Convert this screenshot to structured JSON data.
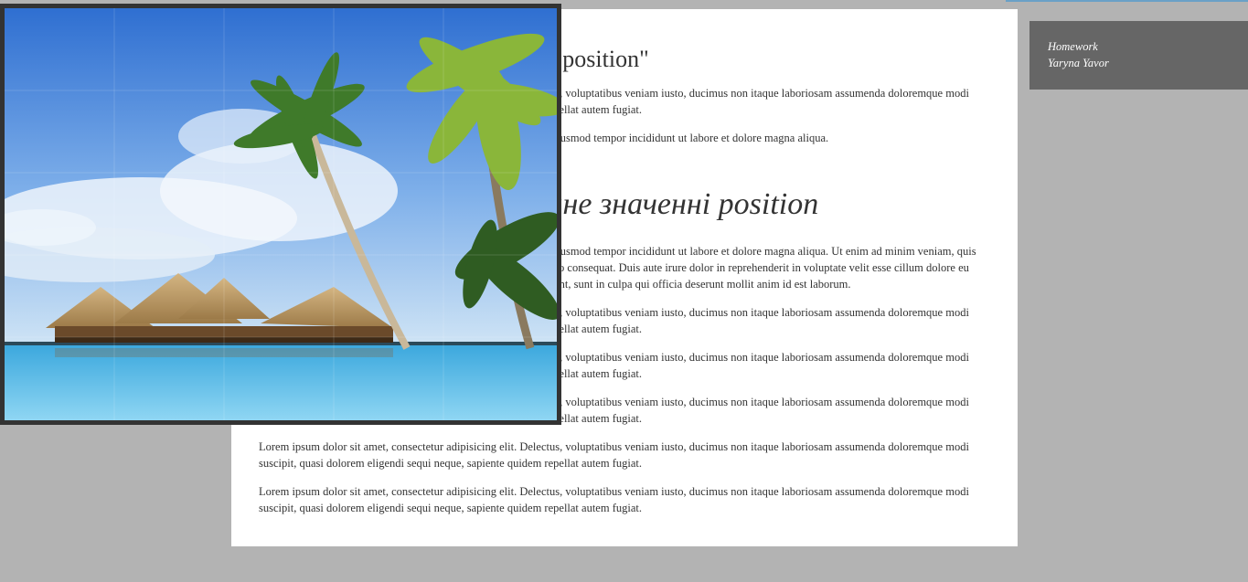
{
  "content": {
    "heading1": "Різні значення властивостям \"position\"",
    "heading2": "Абсолютне та фіксоване значенні position",
    "section1_paragraphs": [
      "Lorem ipsum dolor sit amet, consectetur adipisicing elit. Delectus, voluptatibus veniam iusto, ducimus non itaque laboriosam assumenda doloremque modi suscipit, quasi dolorem eligendi sequi neque, sapiente quidem repellat autem fugiat.",
      "Lorem ipsum dolor sit amet, consectetur adipisicing elit, sed do eiusmod tempor incididunt ut labore et dolore magna aliqua."
    ],
    "section2_paragraphs": [
      "Lorem ipsum dolor sit amet, consectetur adipisicing elit, sed do eiusmod tempor incididunt ut labore et dolore magna aliqua. Ut enim ad minim veniam, quis nostrud exercitation ullamco laboris nisi ut aliquip ex ea commodo consequat. Duis aute irure dolor in reprehenderit in voluptate velit esse cillum dolore eu fugiat nulla pariatur. Excepteur sint occaecat cupidatat non proident, sunt in culpa qui officia deserunt mollit anim id est laborum.",
      "Lorem ipsum dolor sit amet, consectetur adipisicing elit. Delectus, voluptatibus veniam iusto, ducimus non itaque laboriosam assumenda doloremque modi suscipit, quasi dolorem eligendi sequi neque, sapiente quidem repellat autem fugiat.",
      "Lorem ipsum dolor sit amet, consectetur adipisicing elit. Delectus, voluptatibus veniam iusto, ducimus non itaque laboriosam assumenda doloremque modi suscipit, quasi dolorem eligendi sequi neque, sapiente quidem repellat autem fugiat.",
      "Lorem ipsum dolor sit amet, consectetur adipisicing elit. Delectus, voluptatibus veniam iusto, ducimus non itaque laboriosam assumenda doloremque modi suscipit, quasi dolorem eligendi sequi neque, sapiente quidem repellat autem fugiat.",
      "Lorem ipsum dolor sit amet, consectetur adipisicing elit. Delectus, voluptatibus veniam iusto, ducimus non itaque laboriosam assumenda doloremque modi suscipit, quasi dolorem eligendi sequi neque, sapiente quidem repellat autem fugiat.",
      "Lorem ipsum dolor sit amet, consectetur adipisicing elit. Delectus, voluptatibus veniam iusto, ducimus non itaque laboriosam assumenda doloremque modi suscipit, quasi dolorem eligendi sequi neque, sapiente quidem repellat autem fugiat."
    ]
  },
  "sidebar": {
    "line1": "Homework",
    "line2": "Yaryna Yavor"
  },
  "colors": {
    "page_background": "#b3b3b3",
    "content_background": "#ffffff",
    "sidebar_background": "#666666",
    "photo_border": "#333333"
  }
}
